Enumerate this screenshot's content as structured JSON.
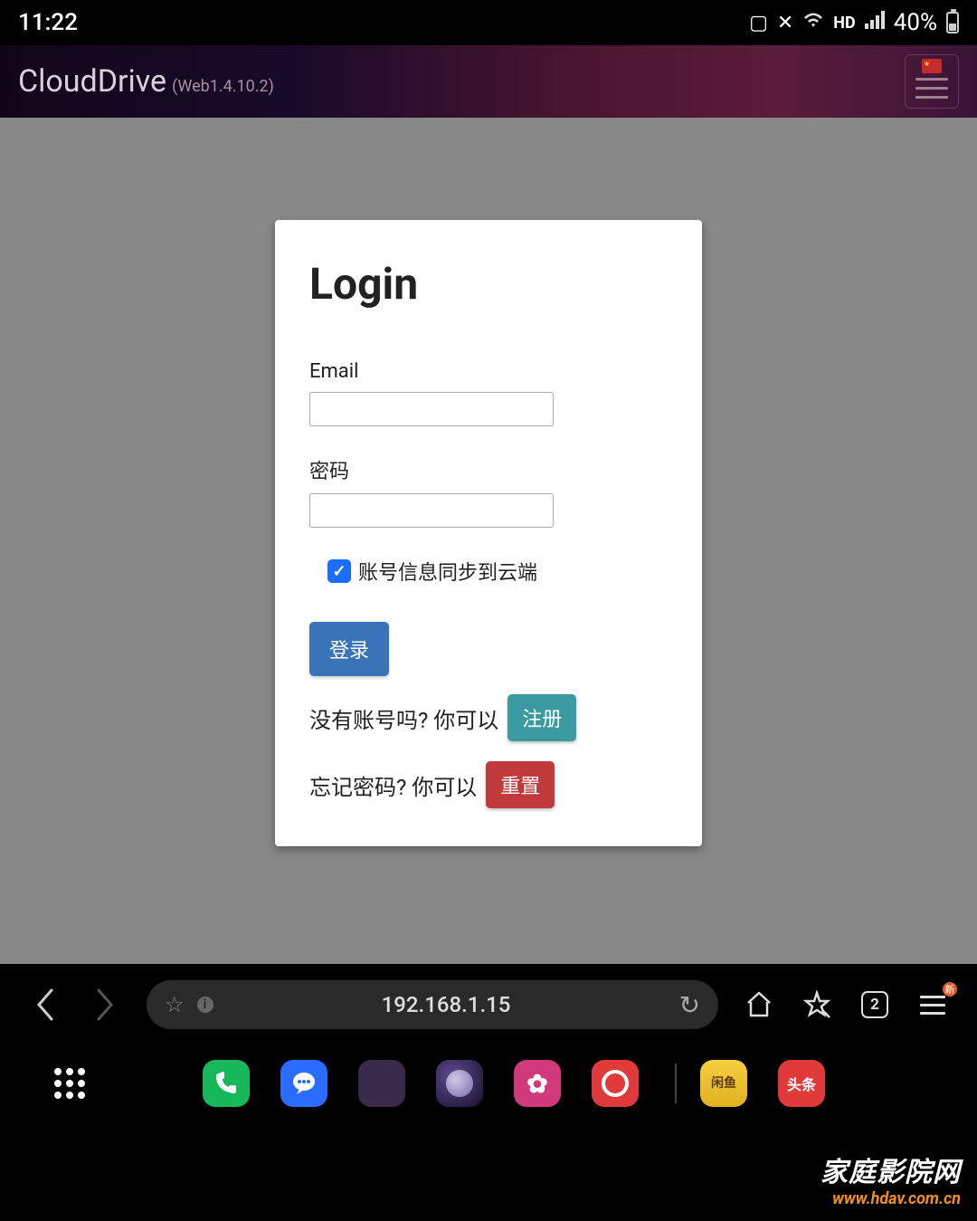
{
  "status": {
    "time": "11:22",
    "hd": "HD",
    "battery_pct": "40%"
  },
  "header": {
    "title": "CloudDrive",
    "version": "(Web1.4.10.2)"
  },
  "login": {
    "title": "Login",
    "email_label": "Email",
    "email_value": "",
    "password_label": "密码",
    "password_value": "",
    "sync_label": "账号信息同步到云端",
    "sync_checked": true,
    "login_btn": "登录",
    "register_prompt": "没有账号吗? 你可以",
    "register_btn": "注册",
    "reset_prompt": "忘记密码? 你可以",
    "reset_btn": "重置"
  },
  "browser": {
    "url": "192.168.1.15",
    "tab_count": "2",
    "menu_badge": "新"
  },
  "watermark": {
    "line1": "家庭影院网",
    "line2": "www.hdav.com.cn"
  },
  "dock": {
    "xianyu": "闲鱼",
    "toutiao": "头条"
  }
}
